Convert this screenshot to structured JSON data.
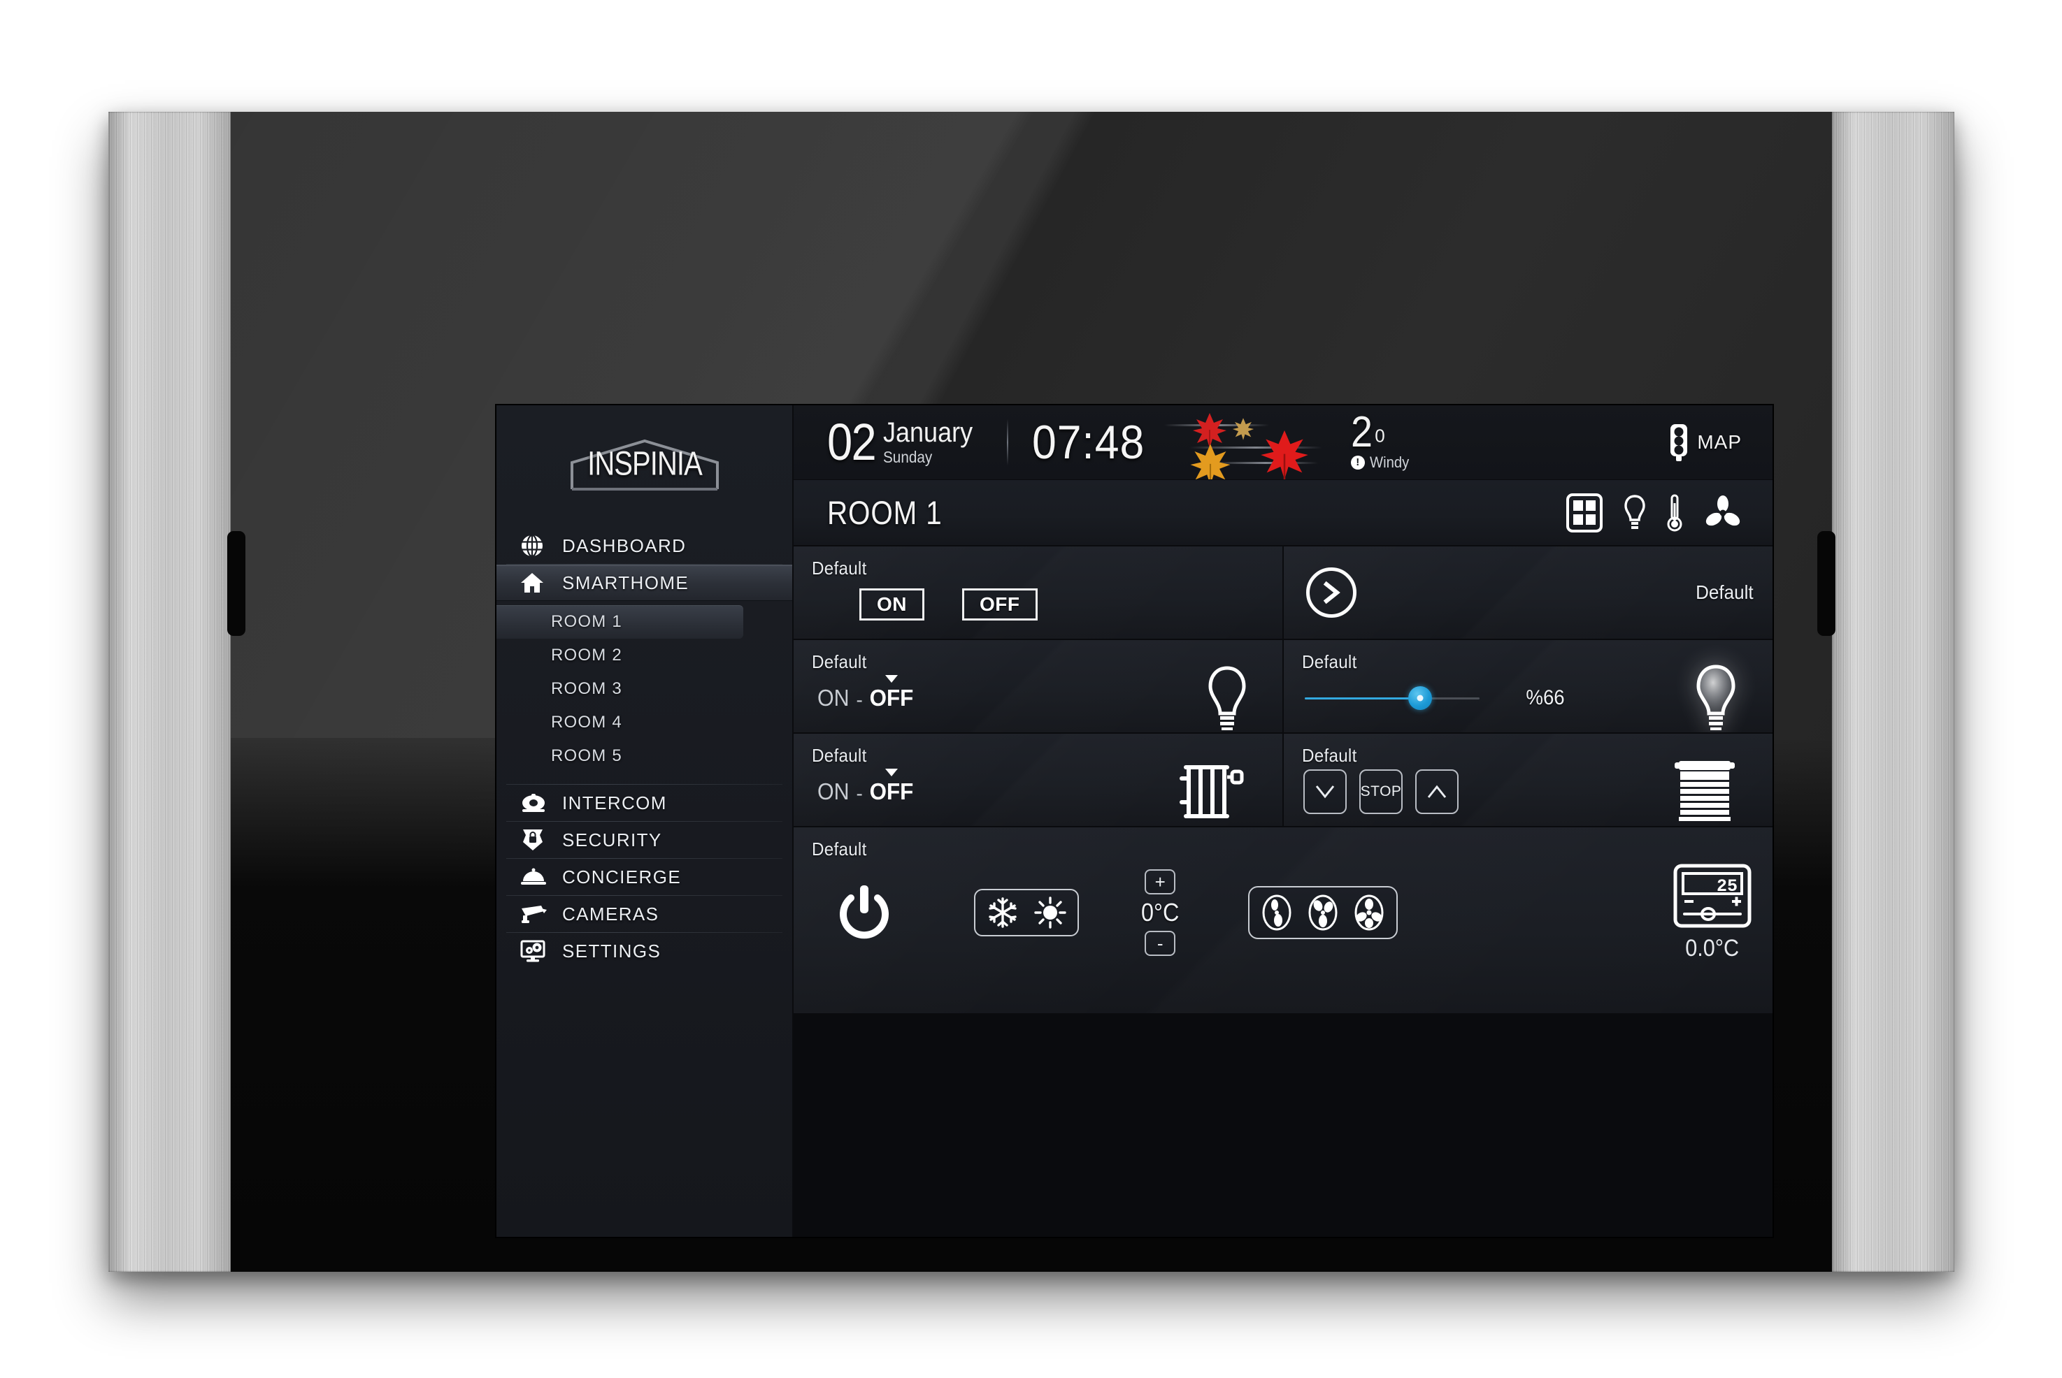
{
  "brand": {
    "name": "INSPINIA",
    "logo_icon": "house-outline-logo"
  },
  "sidebar": {
    "nav": [
      {
        "label": "DASHBOARD",
        "icon": "globe-grid-icon",
        "active": false
      },
      {
        "label": "SMARTHOME",
        "icon": "home-icon",
        "active": true
      }
    ],
    "rooms": [
      {
        "label": "ROOM 1",
        "active": true
      },
      {
        "label": "ROOM 2",
        "active": false
      },
      {
        "label": "ROOM 3",
        "active": false
      },
      {
        "label": "ROOM 4",
        "active": false
      },
      {
        "label": "ROOM 5",
        "active": false
      }
    ],
    "nav_bottom": [
      {
        "label": "INTERCOM",
        "icon": "telephone-icon"
      },
      {
        "label": "SECURITY",
        "icon": "shield-lock-icon"
      },
      {
        "label": "CONCIERGE",
        "icon": "service-bell-icon"
      },
      {
        "label": "CAMERAS",
        "icon": "cctv-camera-icon"
      },
      {
        "label": "SETTINGS",
        "icon": "monitor-gears-icon"
      }
    ]
  },
  "status_bar": {
    "day_number": "02",
    "month": "January",
    "weekday": "Sunday",
    "time": "07:48",
    "weather": {
      "temperature": "2",
      "degree_symbol": "0",
      "condition": "Windy",
      "info_glyph": "!",
      "art_icon": "autumn-leaves-wind-icon"
    },
    "map_button": {
      "label": "MAP",
      "icon": "traffic-light-icon"
    }
  },
  "room_header": {
    "title": "ROOM 1",
    "icons": [
      {
        "name": "window-icon",
        "active": true
      },
      {
        "name": "lightbulb-icon",
        "active": false
      },
      {
        "name": "thermometer-icon",
        "active": false
      },
      {
        "name": "fan-blades-icon",
        "active": false
      }
    ]
  },
  "cards": {
    "switch": {
      "label": "Default",
      "on_label": "ON",
      "off_label": "OFF"
    },
    "scene": {
      "label": "Default",
      "arrow_icon": "chevron-right-circle-icon"
    },
    "light_toggle": {
      "label": "Default",
      "state_on": "ON",
      "state_dash": "-",
      "state_off": "OFF",
      "selected": "OFF",
      "icon": "lightbulb-outline-icon"
    },
    "dimmer": {
      "label": "Default",
      "value_text": "%66",
      "value": 66,
      "accent_color": "#33a9e0",
      "icon": "lightbulb-glow-icon"
    },
    "radiator": {
      "label": "Default",
      "state_on": "ON",
      "state_dash": "-",
      "state_off": "OFF",
      "selected": "OFF",
      "icon": "radiator-icon"
    },
    "shutter": {
      "label": "Default",
      "down_label": "",
      "stop_label": "STOP",
      "up_label": "",
      "down_icon": "chevron-down-icon",
      "up_icon": "chevron-up-icon",
      "icon": "window-blind-icon"
    },
    "hvac": {
      "label": "Default",
      "power_icon": "power-icon",
      "mode_cool_icon": "snowflake-icon",
      "mode_heat_icon": "sun-icon",
      "temp_plus": "+",
      "temp_minus": "-",
      "temp_current": "0°C",
      "fan_low_icon": "fan-low-icon",
      "fan_mid_icon": "fan-mid-icon",
      "fan_high_icon": "fan-high-icon",
      "thermostat_icon": "thermostat-panel-icon",
      "thermostat_setpoint": "25",
      "thermostat_reading": "0.0°C"
    }
  }
}
